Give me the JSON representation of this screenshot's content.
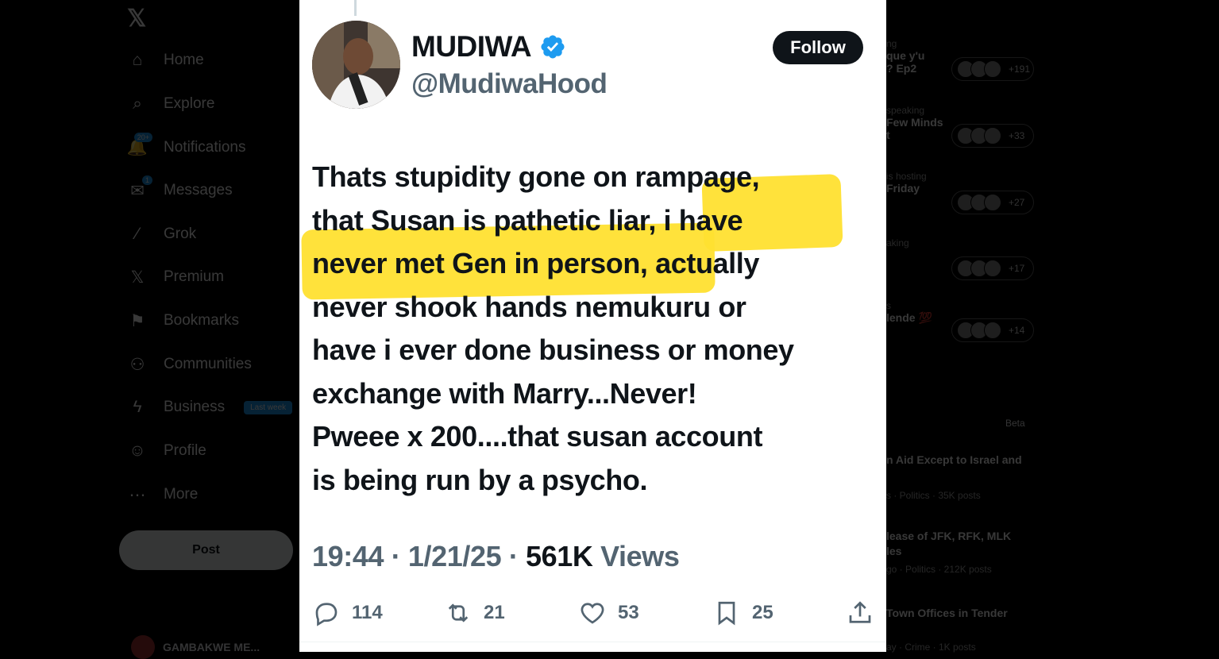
{
  "nav": {
    "logo": "𝕏",
    "items": [
      {
        "label": "Home",
        "icon": "home-icon",
        "glyph": "⌂"
      },
      {
        "label": "Explore",
        "icon": "search-icon",
        "glyph": "⌕"
      },
      {
        "label": "Notifications",
        "icon": "bell-icon",
        "glyph": "🔔",
        "badge": "20+"
      },
      {
        "label": "Messages",
        "icon": "mail-icon",
        "glyph": "✉",
        "badge": "1"
      },
      {
        "label": "Grok",
        "icon": "grok-icon",
        "glyph": "⁄"
      },
      {
        "label": "Premium",
        "icon": "x-icon",
        "glyph": "𝕏"
      },
      {
        "label": "Bookmarks",
        "icon": "bookmark-icon",
        "glyph": "⚑"
      },
      {
        "label": "Communities",
        "icon": "people-icon",
        "glyph": "⚇"
      },
      {
        "label": "Business",
        "icon": "lightning-icon",
        "glyph": "ϟ",
        "tag": "Last week"
      },
      {
        "label": "Profile",
        "icon": "person-icon",
        "glyph": "☺"
      },
      {
        "label": "More",
        "icon": "more-icon",
        "glyph": "⋯"
      }
    ],
    "post_label": "Post",
    "account_name": "GAMBAKWE ME..."
  },
  "sidebar": {
    "spaces": [
      {
        "meta": "ng",
        "title": "que y'u\n? Ep2",
        "count": "+191"
      },
      {
        "meta": "speaking",
        "title": "Few Minds\nt",
        "count": "+33"
      },
      {
        "meta": "is hosting",
        "title": "Friday",
        "count": "+27"
      },
      {
        "meta": "aking",
        "title": "",
        "count": "+17"
      },
      {
        "meta": "s",
        "title": "lende 💯",
        "count": "+14"
      }
    ],
    "beta": "Beta",
    "trends": [
      {
        "title": "n Aid Except to Israel and",
        "meta": "s · Politics · 35K posts"
      },
      {
        "title": "lease of JFK, RFK, MLK\nles",
        "meta": "go · Politics · 212K posts"
      },
      {
        "title": "Town Offices in Tender",
        "meta": "ay · Crime · 1K posts"
      }
    ]
  },
  "tweet": {
    "name": "MUDIWA",
    "handle": "@MudiwaHood",
    "follow_label": "Follow",
    "text_lines": [
      "Thats stupidity gone on rampage,",
      "that Susan is pathetic liar, i have",
      "never met Gen in person, actually",
      "never shook hands nemukuru or",
      "have i ever done business or money",
      "exchange with Marry...Never!",
      "Pweee x 200....that susan account",
      "is being run by a psycho."
    ],
    "time": "19:44",
    "date": "1/21/25",
    "views_count": "561K",
    "views_label": "Views",
    "sep": "·",
    "replies": "114",
    "reposts": "21",
    "likes": "53",
    "bookmarks": "25",
    "highlight_color": "#ffe030"
  }
}
